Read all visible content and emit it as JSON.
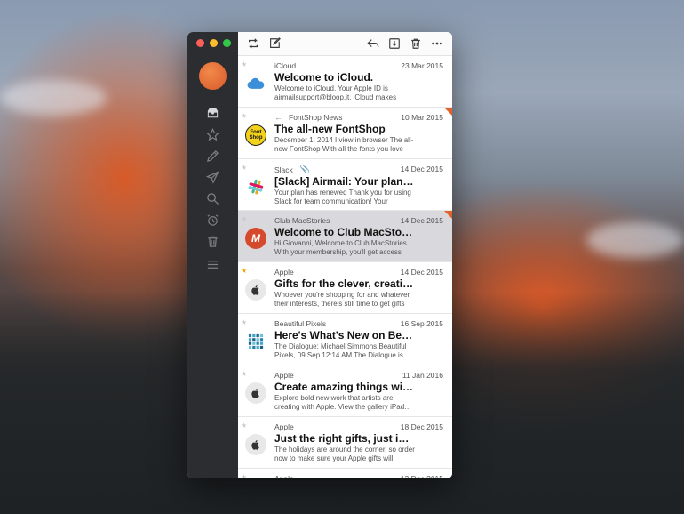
{
  "colors": {
    "accent": "#e2622d",
    "sidebar": "#2b2d30",
    "selected": "#d9d9dd",
    "star": "#f2a100"
  },
  "sidebar": {
    "icons": [
      "inbox-icon",
      "star-icon",
      "pencil-icon",
      "send-icon",
      "search-icon",
      "alarm-icon",
      "trash-icon",
      "menu-icon"
    ]
  },
  "toolbar": {
    "icons": [
      "refresh-icon",
      "compose-icon",
      "reply-icon",
      "archive-icon",
      "trash-icon",
      "more-icon"
    ]
  },
  "messages": [
    {
      "sender": "iCloud",
      "date": "23 Mar 2015",
      "subject": "Welcome to iCloud.",
      "preview": "Welcome to iCloud. Your Apple ID is airmailsupport@bloop.it. iCloud makes sur…",
      "logo": "icloud",
      "starred": false,
      "flagged": false,
      "replied": false,
      "attachment": false,
      "selected": false
    },
    {
      "sender": "FontShop News",
      "date": "10 Mar 2015",
      "subject": "The all-new FontShop",
      "preview": "December 1, 2014 I view in browser The all-new FontShop With all the fonts you love T…",
      "logo": "fontshop",
      "logo_text": "Font Shop",
      "starred": false,
      "flagged": true,
      "replied": true,
      "attachment": false,
      "selected": false
    },
    {
      "sender": "Slack",
      "date": "14 Dec 2015",
      "subject": "[Slack] Airmail: Your plan has…",
      "preview": "Your plan has renewed Thank you for using Slack for team communication! Your month…",
      "logo": "slack",
      "starred": false,
      "flagged": false,
      "replied": false,
      "attachment": true,
      "selected": false
    },
    {
      "sender": "Club MacStories",
      "date": "14 Dec 2015",
      "subject": "Welcome to Club MacStories",
      "preview": "Hi Giovanni, Welcome to Club MacStories. With your membership, you'll get access to…",
      "logo": "club",
      "logo_text": "M",
      "starred": false,
      "flagged": true,
      "replied": false,
      "attachment": false,
      "selected": true
    },
    {
      "sender": "Apple",
      "date": "14 Dec 2015",
      "subject": "Gifts for the clever, creative,…",
      "preview": "Whoever you're shopping for and whatever their interests, there's still time to get gifts t…",
      "logo": "apple",
      "starred": true,
      "flagged": false,
      "replied": false,
      "attachment": false,
      "selected": false
    },
    {
      "sender": "Beautiful Pixels",
      "date": "16 Sep 2015",
      "subject": "Here's What's New on Beaut…",
      "preview": "The Dialogue: Michael Simmons Beautiful Pixels, 09 Sep 12:14 AM The Dialogue is s…",
      "logo": "pixels",
      "starred": false,
      "flagged": false,
      "replied": false,
      "attachment": false,
      "selected": false
    },
    {
      "sender": "Apple",
      "date": "11 Jan 2016",
      "subject": "Create amazing things with…",
      "preview": "Explore bold new work that artists are creating with Apple. View the gallery iPad…",
      "logo": "apple",
      "starred": false,
      "flagged": false,
      "replied": false,
      "attachment": false,
      "selected": false
    },
    {
      "sender": "Apple",
      "date": "18 Dec 2015",
      "subject": "Just the right gifts, just in time.",
      "preview": "The holidays are around the corner, so order now to make sure your Apple gifts will arriv…",
      "logo": "apple",
      "starred": false,
      "flagged": false,
      "replied": false,
      "attachment": false,
      "selected": false
    },
    {
      "sender": "Apple",
      "date": "13 Dec 2015",
      "subject": "",
      "preview": "",
      "logo": "apple",
      "starred": false,
      "flagged": false,
      "replied": false,
      "attachment": false,
      "selected": false
    }
  ]
}
